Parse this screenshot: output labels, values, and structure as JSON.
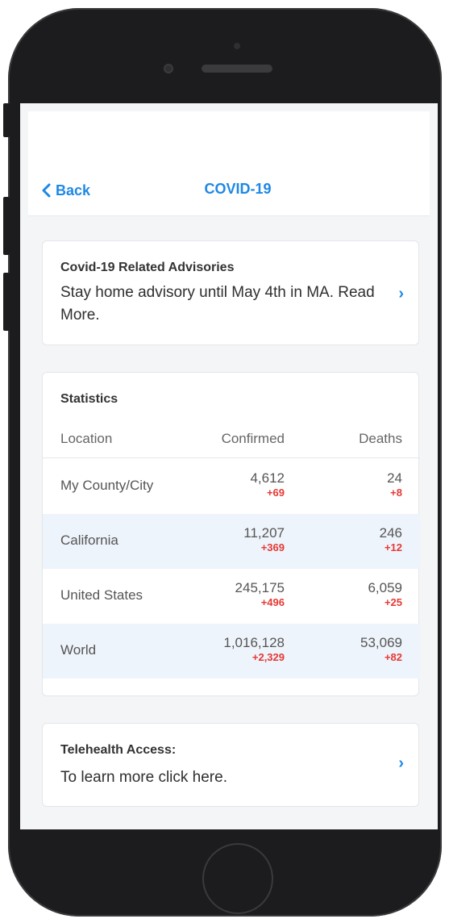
{
  "nav": {
    "back_label": "Back",
    "title": "COVID-19"
  },
  "advisory": {
    "title": "Covid-19 Related Advisories",
    "body": "Stay home advisory until May 4th in MA. Read More."
  },
  "statistics": {
    "title": "Statistics",
    "columns": [
      "Location",
      "Confirmed",
      "Deaths"
    ],
    "rows": [
      {
        "location": "My County/City",
        "confirmed": "4,612",
        "confirmed_change": "+69",
        "deaths": "24",
        "deaths_change": "+8"
      },
      {
        "location": "California",
        "confirmed": "11,207",
        "confirmed_change": "+369",
        "deaths": "246",
        "deaths_change": "+12"
      },
      {
        "location": "United States",
        "confirmed": "245,175",
        "confirmed_change": "+496",
        "deaths": "6,059",
        "deaths_change": "+25"
      },
      {
        "location": "World",
        "confirmed": "1,016,128",
        "confirmed_change": "+2,329",
        "deaths": "53,069",
        "deaths_change": "+82"
      }
    ]
  },
  "telehealth": {
    "title": "Telehealth Access:",
    "body": "To learn more click here."
  },
  "icons": {
    "back": "chevron-left-icon",
    "advisory_go": "chevron-right-icon",
    "telehealth_go": "chevron-right-icon"
  },
  "colors": {
    "accent": "#1e88e5",
    "increase": "#e53935",
    "row_shade": "#eef4fb"
  }
}
